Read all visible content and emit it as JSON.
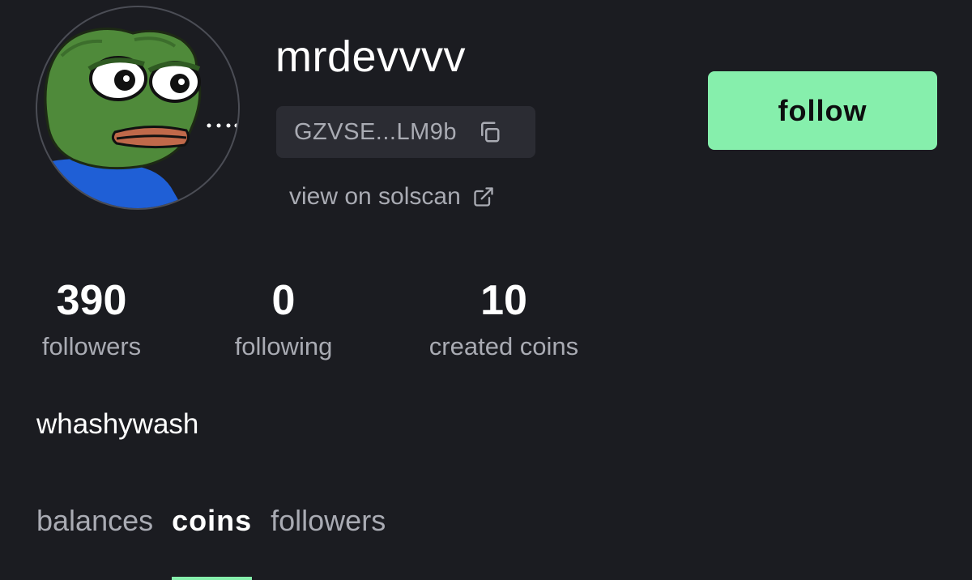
{
  "profile": {
    "username": "mrdevvvv",
    "address": "GZVSE...LM9b",
    "solscan_label": "view on solscan",
    "bio": "whashywash",
    "avatar_icon": "pepe-frog-avatar"
  },
  "actions": {
    "follow_label": "follow"
  },
  "stats": {
    "followers_value": "390",
    "followers_label": "followers",
    "following_value": "0",
    "following_label": "following",
    "created_value": "10",
    "created_label": "created coins"
  },
  "tabs": [
    {
      "label": "balances",
      "active": false
    },
    {
      "label": "coins",
      "active": true
    },
    {
      "label": "followers",
      "active": false
    }
  ],
  "colors": {
    "background": "#1b1c21",
    "accent": "#86efac",
    "muted_text": "#a9abb3",
    "pill": "#2b2c33"
  },
  "icons": {
    "copy": "copy-icon",
    "external_link": "external-link-icon"
  }
}
